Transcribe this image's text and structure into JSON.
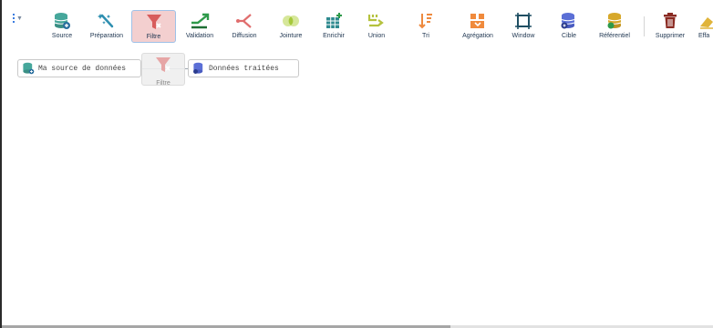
{
  "toolbar": {
    "items": [
      {
        "label": "Source",
        "icon": "database-add-icon"
      },
      {
        "label": "Préparation",
        "icon": "magic-wand-icon"
      },
      {
        "label": "Filtre",
        "icon": "filter-icon",
        "active": true
      },
      {
        "label": "Validation",
        "icon": "validation-arrow-icon"
      },
      {
        "label": "Diffusion",
        "icon": "fork-icon"
      },
      {
        "label": "Jointure",
        "icon": "join-circles-icon"
      },
      {
        "label": "Enrichir",
        "icon": "table-add-icon"
      },
      {
        "label": "Union",
        "icon": "merge-icon"
      },
      {
        "label": "Tri",
        "icon": "sort-icon"
      },
      {
        "label": "Agrégation",
        "icon": "aggregate-icon"
      },
      {
        "label": "Window",
        "icon": "window-icon"
      },
      {
        "label": "Cible",
        "icon": "database-target-icon"
      },
      {
        "label": "Référentiel",
        "icon": "database-reference-icon"
      },
      {
        "label": "Supprimer",
        "icon": "trash-icon"
      },
      {
        "label": "Effa",
        "icon": "eraser-icon"
      }
    ]
  },
  "canvas": {
    "source_node": {
      "label": "Ma source de données",
      "icon": "database-add-icon"
    },
    "target_node": {
      "label": "Données traitées",
      "icon": "database-target-icon"
    },
    "drag_ghost": {
      "label": "Filtre",
      "icon": "filter-icon"
    }
  },
  "colors": {
    "source": "#46a79b",
    "preparation": "#2e8fb0",
    "filter": "#d85c5c",
    "validation": "#2e9a4a",
    "diffusion": "#e06d6d",
    "jointure": "#a6c93b",
    "enrichir": "#2f8a8f",
    "union": "#b5c23e",
    "tri": "#ee8a3f",
    "agregation": "#f08a3c",
    "window": "#1f4f63",
    "cible": "#5b6fd6",
    "referentiel": "#d7a82a",
    "supprimer": "#8a2a22",
    "effacer": "#e0b43a"
  }
}
